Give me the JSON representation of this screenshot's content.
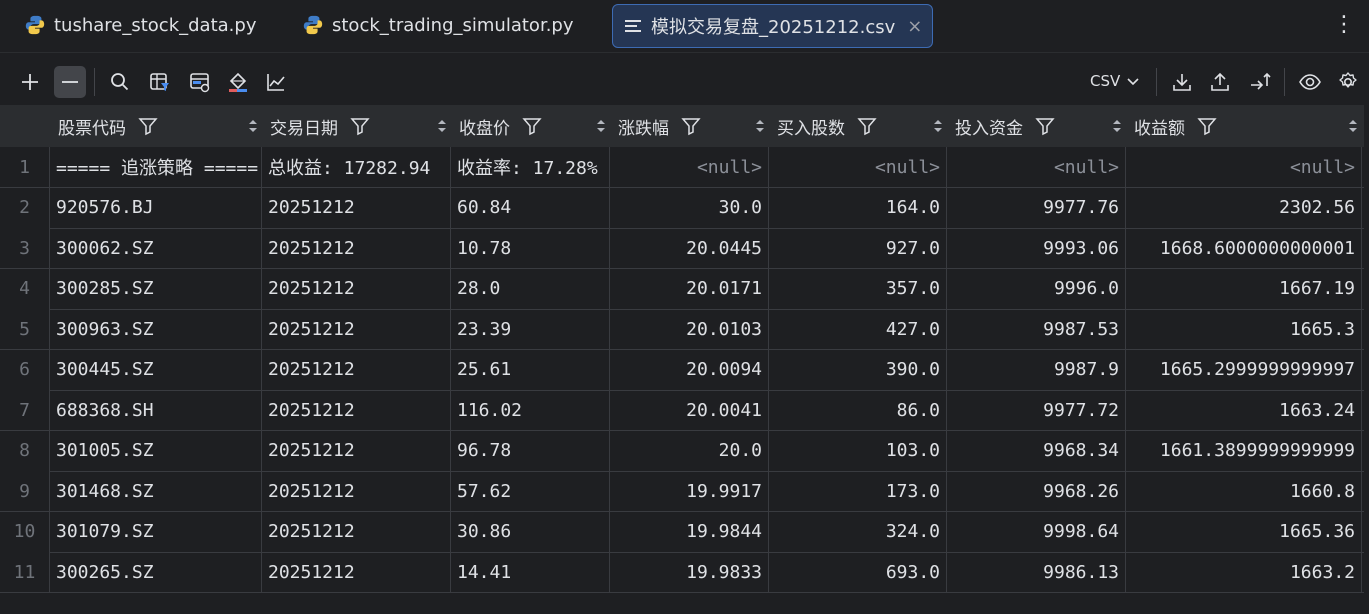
{
  "tabs": [
    {
      "label": "tushare_stock_data.py",
      "icon": "python-icon"
    },
    {
      "label": "stock_trading_simulator.py",
      "icon": "python-icon"
    },
    {
      "label": "模拟交易复盘_20251212.csv",
      "icon": "csv-file-icon",
      "close": "×"
    }
  ],
  "menu_glyph": "⋮",
  "toolbar": {
    "format": "CSV"
  },
  "columns": [
    "股票代码",
    "交易日期",
    "收盘价",
    "涨跌幅",
    "买入股数",
    "投入资金",
    "收益额"
  ],
  "rows": [
    {
      "n": "1",
      "c": [
        "===== 追涨策略 =====",
        "总收益: 17282.94",
        "收益率: 17.28%",
        "<null>",
        "<null>",
        "<null>",
        "<null>"
      ]
    },
    {
      "n": "2",
      "c": [
        "920576.BJ",
        "20251212",
        "60.84",
        "30.0",
        "164.0",
        "9977.76",
        "2302.56"
      ]
    },
    {
      "n": "3",
      "c": [
        "300062.SZ",
        "20251212",
        "10.78",
        "20.0445",
        "927.0",
        "9993.06",
        "1668.6000000000001"
      ]
    },
    {
      "n": "4",
      "c": [
        "300285.SZ",
        "20251212",
        "28.0",
        "20.0171",
        "357.0",
        "9996.0",
        "1667.19"
      ]
    },
    {
      "n": "5",
      "c": [
        "300963.SZ",
        "20251212",
        "23.39",
        "20.0103",
        "427.0",
        "9987.53",
        "1665.3"
      ]
    },
    {
      "n": "6",
      "c": [
        "300445.SZ",
        "20251212",
        "25.61",
        "20.0094",
        "390.0",
        "9987.9",
        "1665.2999999999997"
      ]
    },
    {
      "n": "7",
      "c": [
        "688368.SH",
        "20251212",
        "116.02",
        "20.0041",
        "86.0",
        "9977.72",
        "1663.24"
      ]
    },
    {
      "n": "8",
      "c": [
        "301005.SZ",
        "20251212",
        "96.78",
        "20.0",
        "103.0",
        "9968.34",
        "1661.3899999999999"
      ]
    },
    {
      "n": "9",
      "c": [
        "301468.SZ",
        "20251212",
        "57.62",
        "19.9917",
        "173.0",
        "9968.26",
        "1660.8"
      ]
    },
    {
      "n": "10",
      "c": [
        "301079.SZ",
        "20251212",
        "30.86",
        "19.9844",
        "324.0",
        "9998.64",
        "1665.36"
      ]
    },
    {
      "n": "11",
      "c": [
        "300265.SZ",
        "20251212",
        "14.41",
        "19.9833",
        "693.0",
        "9986.13",
        "1663.2"
      ]
    }
  ],
  "colors": {
    "background": "#1e1f22",
    "header": "#2b2d30",
    "active_tab": "#253654",
    "active_tab_border": "#3d6bb3"
  }
}
